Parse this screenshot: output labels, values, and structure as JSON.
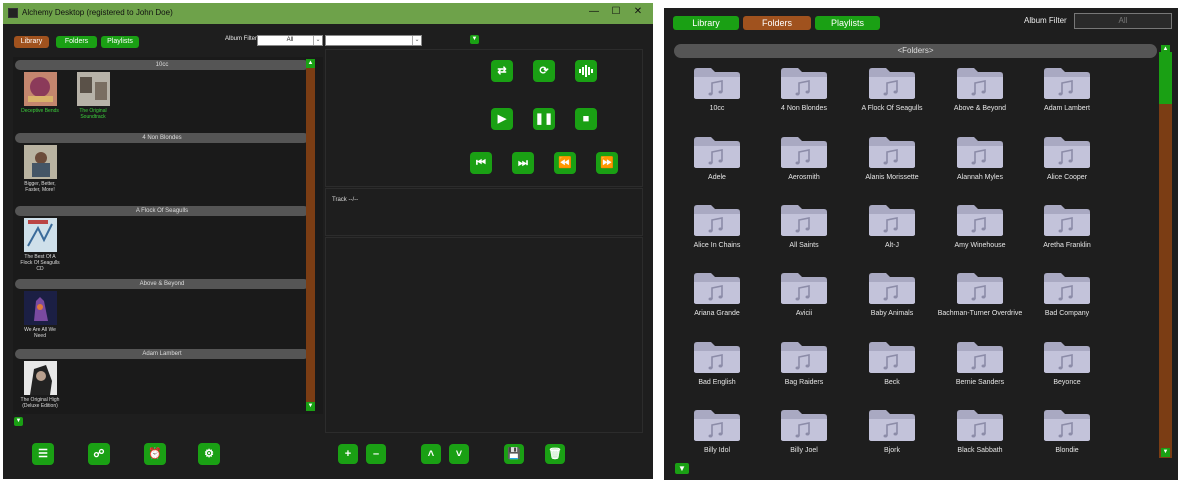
{
  "left_window": {
    "title": "Alchemy Desktop (registered to John Doe)",
    "controls": [
      "—",
      "☐",
      "✕"
    ],
    "tabs": [
      "Library",
      "Folders",
      "Playlists"
    ],
    "album_filter_label": "Album Filter",
    "album_filter_value": "All",
    "search_value": "",
    "groups": [
      {
        "name": "10cc",
        "albums": [
          "Deceptive Bends",
          "The Original Soundtrack"
        ]
      },
      {
        "name": "4 Non Blondes",
        "albums": [
          "Bigger, Better, Faster, More!"
        ]
      },
      {
        "name": "A Flock Of Seagulls",
        "albums": [
          "The Best Of A Flock Of Seagulls CD"
        ]
      },
      {
        "name": "Above & Beyond",
        "albums": [
          "We Are All We Need"
        ]
      },
      {
        "name": "Adam Lambert",
        "albums": [
          "The Original High (Deluxe Edition)"
        ]
      }
    ],
    "track_label": "Track --/--",
    "player_buttons": [
      "shuffle-icon",
      "repeat-icon",
      "equalizer-icon",
      "play-icon",
      "pause-icon",
      "stop-icon",
      "previous-icon",
      "next-icon",
      "rewind-icon",
      "fast-forward-icon"
    ],
    "bottom_left_buttons": [
      "list-icon",
      "link-icon",
      "alarm-icon",
      "gear-icon"
    ],
    "bottom_right_buttons": [
      "plus-icon",
      "minus-icon",
      "up-icon",
      "down-icon",
      "save-icon",
      "trash-icon"
    ],
    "colors": {
      "accent_green": "#1aa014",
      "accent_orange": "#a0521e",
      "titlebar": "#6ea24a",
      "background": "#1e1e1e",
      "scroll": "#7b3d14"
    }
  },
  "right_window": {
    "tabs": [
      "Library",
      "Folders",
      "Playlists"
    ],
    "album_filter_label": "Album Filter",
    "album_filter_value": "All",
    "folders_header": "<Folders>",
    "folders": [
      "10cc",
      "4 Non Blondes",
      "A Flock Of Seagulls",
      "Above & Beyond",
      "Adam Lambert",
      "Adele",
      "Aerosmith",
      "Alanis Morissette",
      "Alannah Myles",
      "Alice Cooper",
      "Alice In Chains",
      "All Saints",
      "Alt-J",
      "Amy Winehouse",
      "Aretha Franklin",
      "Ariana Grande",
      "Avicii",
      "Baby Animals",
      "Bachman-Turner Overdrive",
      "Bad Company",
      "Bad English",
      "Bag Raiders",
      "Beck",
      "Bernie Sanders",
      "Beyonce",
      "Billy Idol",
      "Billy Joel",
      "Bjork",
      "Black Sabbath",
      "Blondie"
    ]
  }
}
